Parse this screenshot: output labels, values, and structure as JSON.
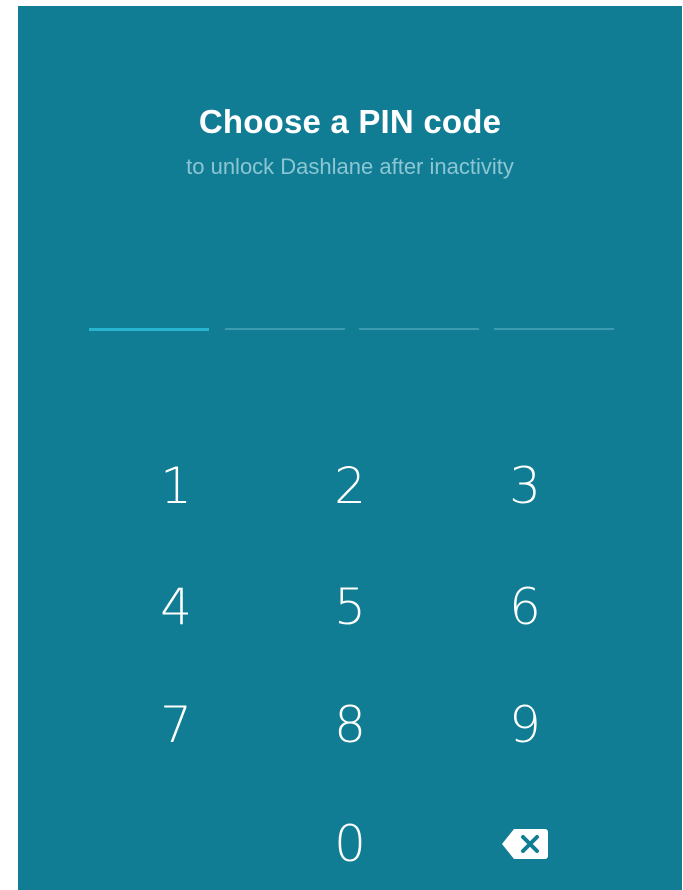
{
  "header": {
    "title": "Choose a PIN code",
    "subtitle": "to unlock Dashlane after inactivity"
  },
  "pin": {
    "length": 4,
    "entered": 0
  },
  "keypad": {
    "keys": [
      "1",
      "2",
      "3",
      "4",
      "5",
      "6",
      "7",
      "8",
      "9",
      "0"
    ],
    "backspace_icon": "backspace-icon"
  },
  "colors": {
    "background": "#117d95",
    "subtitle": "#8cc6d3",
    "slot_active": "#27b4cf",
    "slot_inactive": "#3d9bb0"
  }
}
